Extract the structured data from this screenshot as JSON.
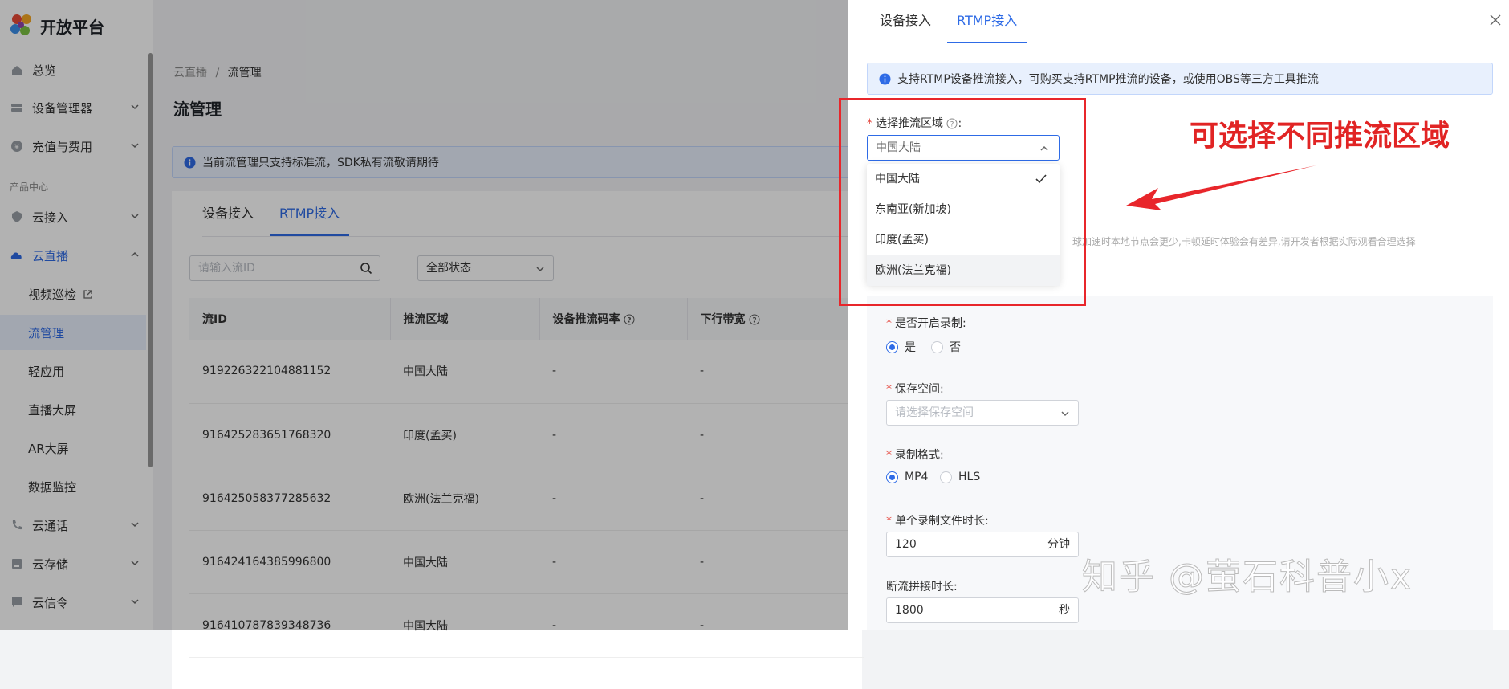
{
  "brand": {
    "name": "开放平台"
  },
  "sidebar": {
    "section_label": "产品中心",
    "items": [
      {
        "label": "总览",
        "icon": "home-icon"
      },
      {
        "label": "设备管理器",
        "icon": "device-icon"
      },
      {
        "label": "充值与费用",
        "icon": "coin-icon"
      },
      {
        "label": "云接入",
        "icon": "shield-icon"
      },
      {
        "label": "云直播",
        "icon": "cloud-upload-icon"
      },
      {
        "label": "视频巡检",
        "icon": "external-link-icon"
      },
      {
        "label": "流管理"
      },
      {
        "label": "轻应用"
      },
      {
        "label": "直播大屏"
      },
      {
        "label": "AR大屏"
      },
      {
        "label": "数据监控"
      },
      {
        "label": "云通话",
        "icon": "phone-icon"
      },
      {
        "label": "云存储",
        "icon": "storage-icon"
      },
      {
        "label": "云信令",
        "icon": "message-icon"
      }
    ]
  },
  "breadcrumb": {
    "parent": "云直播",
    "separator": "/",
    "current": "流管理"
  },
  "page_title": "流管理",
  "notice": "当前流管理只支持标准流，SDK私有流敬请期待",
  "main_tabs": [
    "设备接入",
    "RTMP接入"
  ],
  "search": {
    "placeholder": "请输入流ID"
  },
  "status_filter": "全部状态",
  "table": {
    "columns": [
      "流ID",
      "推流区域",
      "设备推流码率",
      "下行带宽"
    ],
    "rows": [
      [
        "919226322104881152",
        "中国大陆",
        "-",
        "-"
      ],
      [
        "916425283651768320",
        "印度(孟买)",
        "-",
        "-"
      ],
      [
        "916425058377285632",
        "欧洲(法兰克福)",
        "-",
        "-"
      ],
      [
        "916424164385996800",
        "中国大陆",
        "-",
        "-"
      ],
      [
        "916410787839348736",
        "中国大陆",
        "-",
        "-"
      ]
    ]
  },
  "drawer": {
    "tabs": [
      "设备接入",
      "RTMP接入"
    ],
    "notice": "支持RTMP设备推流接入，可购买支持RTMP推流的设备，或使用OBS等三方工具推流",
    "region_label": "选择推流区域",
    "region_value": "中国大陆",
    "region_options": [
      "中国大陆",
      "东南亚(新加坡)",
      "印度(孟买)",
      "欧洲(法兰克福)"
    ],
    "faded_hint": "球加速时本地节点会更少,卡顿延时体验会有差异,请开发者根据实际观看合理选择",
    "record_label": "是否开启录制:",
    "record_options": [
      "是",
      "否"
    ],
    "storage_label": "保存空间:",
    "storage_placeholder": "请选择保存空间",
    "format_label": "录制格式:",
    "format_options": [
      "MP4",
      "HLS"
    ],
    "duration_label": "单个录制文件时长:",
    "duration_value": "120",
    "duration_unit": "分钟",
    "splice_label": "断流拼接时长:",
    "splice_value": "1800",
    "splice_unit": "秒"
  },
  "annotation": {
    "text": "可选择不同推流区域",
    "color": "#e12424"
  },
  "watermark": "知乎 @萤石科普小x",
  "colors": {
    "accent": "#2e6be6",
    "required": "#e5483e"
  }
}
